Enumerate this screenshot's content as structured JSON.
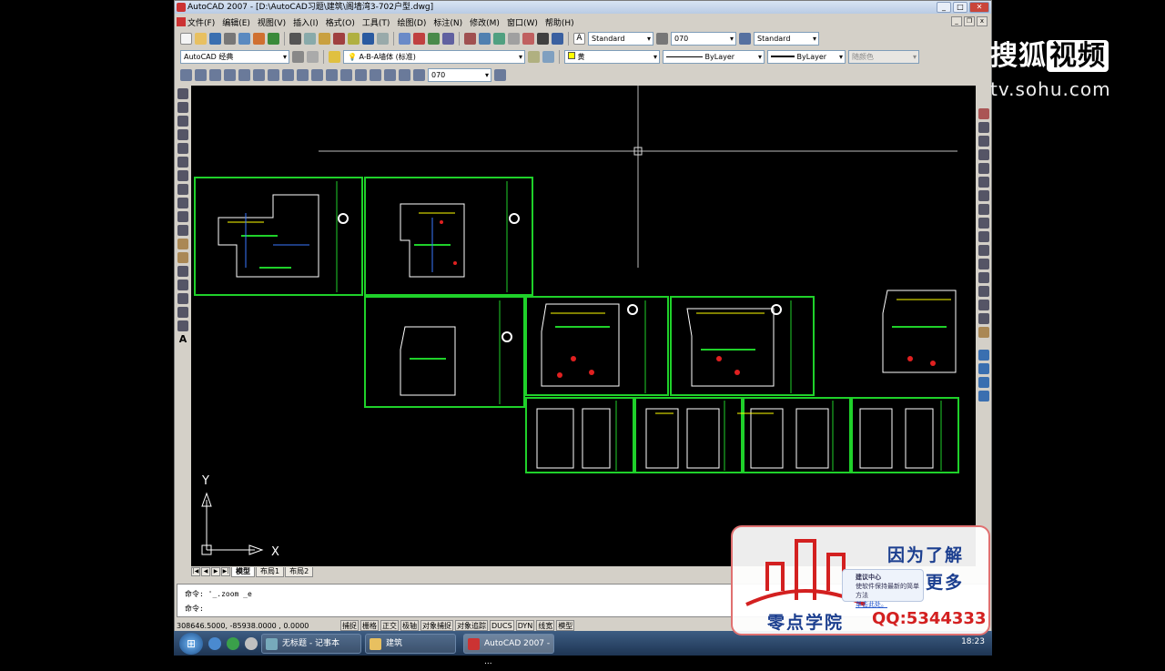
{
  "window": {
    "title": "AutoCAD 2007 - [D:\\AutoCAD习题\\建筑\\阁墙湾3-702户型.dwg]"
  },
  "menu": [
    "文件(F)",
    "编辑(E)",
    "视图(V)",
    "插入(I)",
    "格式(O)",
    "工具(T)",
    "绘图(D)",
    "标注(N)",
    "修改(M)",
    "窗口(W)",
    "帮助(H)"
  ],
  "toolbar": {
    "text_style": "Standard",
    "dim_style": "070",
    "table_style": "Standard",
    "workspace": "AutoCAD 经典",
    "layer": "A-B-A墙体 (标准)",
    "color": "黄",
    "linetype": "ByLayer",
    "lineweight": "ByLayer",
    "plotstyle": "随颜色",
    "dim_style2": "070"
  },
  "ucs": {
    "x": "X",
    "y": "Y"
  },
  "tabs": [
    "模型",
    "布局1",
    "布局2"
  ],
  "command": {
    "line1": "命令: '_.zoom _e",
    "line2": "命令:"
  },
  "status": {
    "coords": "308646.5000, -85938.0000 , 0.0000",
    "buttons": [
      "捕捉",
      "栅格",
      "正交",
      "极轴",
      "对象捕捉",
      "对象追踪",
      "DUCS",
      "DYN",
      "线宽",
      "模型"
    ]
  },
  "taskbar": {
    "items": [
      "无标题 - 记事本",
      "建筑",
      "AutoCAD 2007 - ..."
    ],
    "clock": "18:23"
  },
  "watermark": {
    "brand": "搜狐",
    "brand_box": "视频",
    "url": "tv.sohu.com"
  },
  "ad": {
    "slogan1": "因为了解",
    "slogan2": "创造更多",
    "school": "零点学院",
    "qq": "QQ:5344333",
    "notice_title": "建议中心",
    "notice_body": "使软件保持最新的简单方法",
    "notice_link": "单击此处。"
  },
  "colors": {
    "frame": "#1fd12a",
    "canvas": "#000000",
    "accent": "#d32020"
  }
}
